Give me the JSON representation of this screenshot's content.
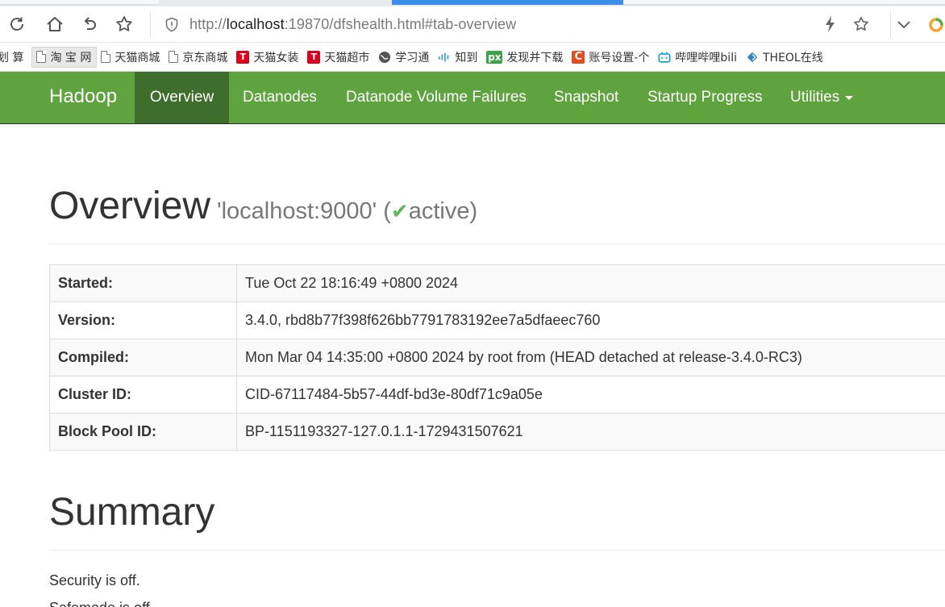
{
  "browser": {
    "url_prefix": "http://",
    "url_host": "localhost",
    "url_rest": ":19870/dfshealth.html#tab-overview",
    "icons": [
      "refresh-icon",
      "home-icon",
      "undo-icon",
      "star-icon",
      "shield-icon",
      "lightning-icon",
      "star-icon",
      "chevron-down-icon"
    ]
  },
  "bookmarks": [
    {
      "label": "划 算",
      "icon": "none"
    },
    {
      "label": "淘 宝 网",
      "icon": "doc",
      "selected": true
    },
    {
      "label": "天猫商城",
      "icon": "doc"
    },
    {
      "label": "京东商城",
      "icon": "doc"
    },
    {
      "label": "天猫女装",
      "icon": "tmall",
      "glyph": "T"
    },
    {
      "label": "天猫超市",
      "icon": "tmall",
      "glyph": "T"
    },
    {
      "label": "学习通",
      "icon": "globe"
    },
    {
      "label": "知到",
      "icon": "bars"
    },
    {
      "label": "发现并下载",
      "icon": "px",
      "glyph": "px"
    },
    {
      "label": "账号设置-个",
      "icon": "csdn",
      "glyph": "C"
    },
    {
      "label": "哔哩哔哩bili",
      "icon": "bili"
    },
    {
      "label": "THEOL在线",
      "icon": "theol"
    }
  ],
  "navbar": {
    "brand": "Hadoop",
    "items": [
      "Overview",
      "Datanodes",
      "Datanode Volume Failures",
      "Snapshot",
      "Startup Progress",
      "Utilities"
    ],
    "active": "Overview",
    "bg_color": "#5fa33e",
    "active_color": "#3e6e2b"
  },
  "overview": {
    "title": "Overview",
    "host": "'localhost:9000'",
    "paren_open": "(",
    "status_check": "✔",
    "status": "active",
    "paren_close": ")",
    "rows": [
      {
        "key": "Started:",
        "value": "Tue Oct 22 18:16:49 +0800 2024"
      },
      {
        "key": "Version:",
        "value": "3.4.0, rbd8b77f398f626bb7791783192ee7a5dfaeec760"
      },
      {
        "key": "Compiled:",
        "value": "Mon Mar 04 14:35:00 +0800 2024 by root from (HEAD detached at release-3.4.0-RC3)"
      },
      {
        "key": "Cluster ID:",
        "value": "CID-67117484-5b57-44df-bd3e-80df71c9a05e"
      },
      {
        "key": "Block Pool ID:",
        "value": "BP-1151193327-127.0.1.1-1729431507621"
      }
    ]
  },
  "summary": {
    "title": "Summary",
    "lines": [
      "Security is off.",
      "Safemode is off."
    ]
  }
}
